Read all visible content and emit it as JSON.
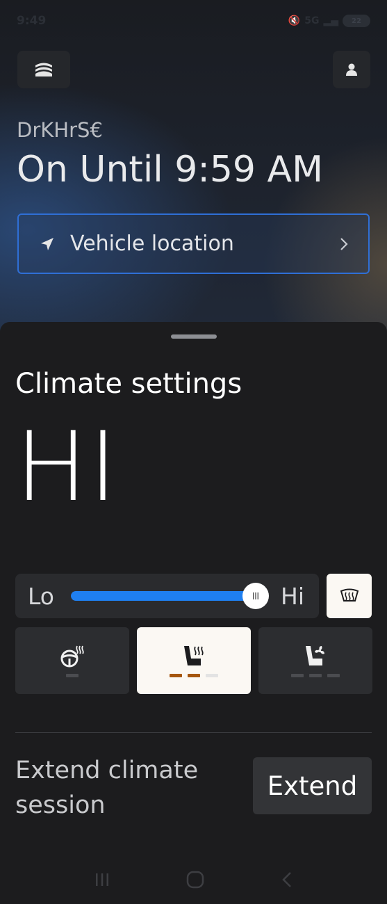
{
  "status_bar": {
    "time": "9:49",
    "network": "5G",
    "battery": "22"
  },
  "header": {
    "menu_icon": "car-stack-icon",
    "profile_icon": "person-icon",
    "vehicle_name": "DrKHrS€",
    "status": "On Until 9:59 AM",
    "location_label": "Vehicle location"
  },
  "climate": {
    "title": "Climate settings",
    "temperature": "HI",
    "slider": {
      "low_label": "Lo",
      "high_label": "Hi",
      "value_fraction": 1.0
    },
    "defrost_icon": "rear-defrost-icon",
    "modes": [
      {
        "name": "heated-steering",
        "icon": "heated-steering-wheel-icon",
        "active": false,
        "levels": 1,
        "level_on": 0
      },
      {
        "name": "heated-seat",
        "icon": "heated-seat-icon",
        "active": true,
        "levels": 3,
        "level_on": 2
      },
      {
        "name": "ventilated-seat",
        "icon": "ventilated-seat-icon",
        "active": false,
        "levels": 3,
        "level_on": 0
      }
    ],
    "extend_label": "Extend climate session",
    "extend_button": "Extend"
  },
  "colors": {
    "accent": "#1f7ff0",
    "active_bg": "#fbf8f3",
    "level_on": "#a5560f"
  }
}
